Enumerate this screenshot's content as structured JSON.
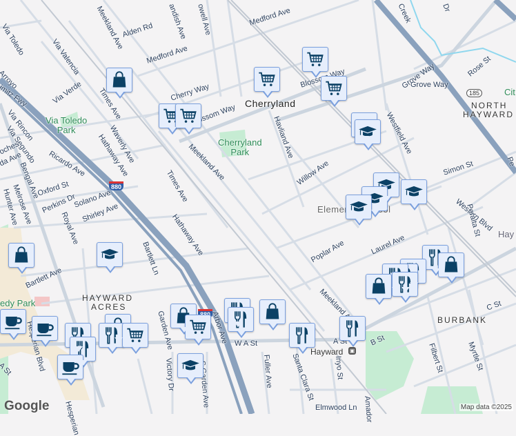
{
  "colors": {
    "background": "#f4f3f4",
    "road": "#d6dde6",
    "highway": "#8aa1bd",
    "park": "#c6ecd3",
    "water": "#8fd7ee",
    "pin_bg": "#e6eefc",
    "pin_border": "#7ba0de",
    "icon": "#0b4165"
  },
  "labels": [
    "Meekland Ave",
    "Alden Rd",
    "andish Ave",
    "owell Ave",
    "Medford Ave",
    "Medford Ave",
    "Via Toledo",
    "Via Valencia",
    "Via Verde",
    "Arroyo",
    "imitz Fwy",
    "Via Rincon",
    "Via Segundo",
    "oches",
    "da Ave",
    "Times Ave",
    "Waverly Ave",
    "Hathaway Ave",
    "Cherry Way",
    "Blossom Way",
    "Blossom Way",
    "Meekland Ave",
    "Times Ave",
    "Ricardo Ave",
    "Bengal Ave",
    "Melrose Ave",
    "Hunter Ave",
    "Oxford St",
    "Perkins Dr",
    "Solano Ave",
    "Shirley Ave",
    "Royal Ave",
    "Hathaway Ave",
    "Bartlett Ln",
    "Bartlett Ave",
    "Havliand Ave",
    "Willow Ave",
    "Grove Way",
    "Grove Way",
    "Westfield Ave",
    "Rose St",
    "Simon St",
    "Western Blvd",
    "Peralta St",
    "Poplar Ave",
    "Laurel Ave",
    "Meekland Ave",
    "C St",
    "B St",
    "W A St",
    "A St",
    "Filbert St",
    "Myrtle St",
    "Fuller Ave",
    "Santa Clara St",
    "Inyo St",
    "Amador",
    "Elmwood Ln",
    "Garden Ave",
    "Arbor Ave",
    "Victory Dr",
    "S Garden Ave",
    "Hesperian Blvd",
    "Hesperian",
    "A St",
    "Creek",
    "Dr",
    "Pe"
  ],
  "places": {
    "cherryland": "Cherryland",
    "north_hayward": [
      "NORTH",
      "HAYWARD"
    ],
    "hayward_acres": [
      "HAYWARD",
      "ACRES"
    ],
    "burbank": "BURBANK",
    "via_toledo_park": [
      "Via Toledo",
      "Park"
    ],
    "cherryland_park": [
      "Cherryland",
      "Park"
    ],
    "kennedy_park": "edy Park",
    "elementary_school": "Elemen        hool",
    "hayward_station": "Hayward",
    "hayward_edge": "Hay",
    "city_edge": "Cit"
  },
  "shields": {
    "i880": "880",
    "i880b": "880",
    "ca185": "185"
  },
  "markers": [
    "shopping-bag",
    "cart",
    "cart",
    "cart",
    "cart",
    "cart",
    "school",
    "school",
    "school",
    "school",
    "school",
    "school",
    "shopping-bag",
    "school",
    "coffee",
    "coffee",
    "restaurant",
    "restaurant",
    "coffee",
    "shopping-bag",
    "restaurant",
    "cart",
    "shopping-bag",
    "cart",
    "restaurant",
    "restaurant",
    "school",
    "shopping-bag",
    "restaurant",
    "restaurant",
    "restaurant",
    "restaurant",
    "restaurant",
    "restaurant",
    "shopping-bag",
    "restaurant",
    "shopping-bag"
  ],
  "attribution": {
    "logo": "Google",
    "map_data": "Map data ©2025"
  }
}
